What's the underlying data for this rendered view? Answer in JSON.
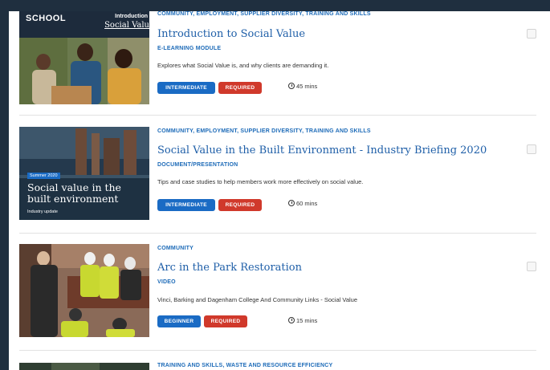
{
  "items": [
    {
      "tags": "COMMUNITY, EMPLOYMENT, SUPPLIER DIVERSITY, TRAINING AND SKILLS",
      "title": "Introduction to Social Value",
      "type": "E-LEARNING MODULE",
      "description": "Explores what Social Value is, and why clients are demanding it.",
      "level": "INTERMEDIATE",
      "requirement": "REQUIRED",
      "duration": "45 mins",
      "thumbnail": {
        "brand": "SCHOOL",
        "heading_line1": "Introduction",
        "heading_line2": "Social Valu"
      }
    },
    {
      "tags": "COMMUNITY, EMPLOYMENT, SUPPLIER DIVERSITY, TRAINING AND SKILLS",
      "title": "Social Value in the Built Environment - Industry Briefing 2020",
      "type": "DOCUMENT/PRESENTATION",
      "description": "Tips and case studies to help members work more effectively on social value.",
      "level": "INTERMEDIATE",
      "requirement": "REQUIRED",
      "duration": "60 mins",
      "thumbnail": {
        "tag": "Summer 2020",
        "line1": "Social value in the",
        "line2": "built environment",
        "caption": "Industry update"
      }
    },
    {
      "tags": "COMMUNITY",
      "title": "Arc in the Park Restoration",
      "type": "VIDEO",
      "description": "Vinci, Barking and Dagenham College And Community Links - Social Value",
      "level": "BEGINNER",
      "requirement": "REQUIRED",
      "duration": "15 mins"
    },
    {
      "tags": "TRAINING AND SKILLS, WASTE AND RESOURCE EFFICIENCY"
    }
  ],
  "colors": {
    "page_background": "#1f2f3f",
    "link_blue": "#1f5fa8",
    "level_badge": "#1a6bc4",
    "required_badge": "#d0392b"
  }
}
